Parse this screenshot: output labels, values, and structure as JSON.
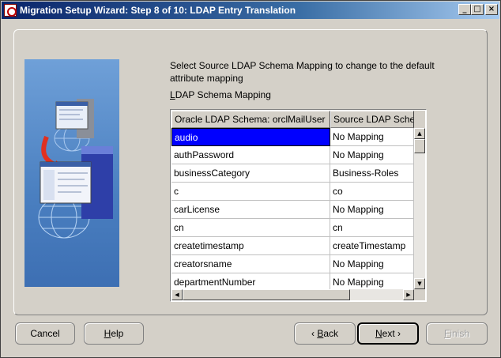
{
  "window": {
    "title": "Migration Setup Wizard:  Step 8 of 10: LDAP Entry Translation",
    "minimize": "_",
    "maximize": "□",
    "close": "×"
  },
  "intro": {
    "text": "Select Source LDAP Schema Mapping to change to the default attribute mapping"
  },
  "grid": {
    "label": "LDAP Schema Mapping",
    "columns": [
      "Oracle LDAP Schema: orclMailUser",
      "Source LDAP Schema"
    ],
    "rows": [
      [
        "audio",
        "No Mapping"
      ],
      [
        "authPassword",
        "No Mapping"
      ],
      [
        "businessCategory",
        "Business-Roles"
      ],
      [
        "c",
        "co"
      ],
      [
        "carLicense",
        "No Mapping"
      ],
      [
        "cn",
        "cn"
      ],
      [
        "createtimestamp",
        "createTimestamp"
      ],
      [
        "creatorsname",
        "No Mapping"
      ],
      [
        "departmentNumber",
        "No Mapping"
      ]
    ]
  },
  "buttons": {
    "cancel": "Cancel",
    "help": "Help",
    "back": "Back",
    "next": "Next",
    "finish": "Finish"
  },
  "icons": {
    "back_arrow": "‹",
    "next_arrow": "›",
    "up_arrow": "▲",
    "down_arrow": "▼",
    "left_arrow": "◀",
    "right_arrow": "▶"
  }
}
